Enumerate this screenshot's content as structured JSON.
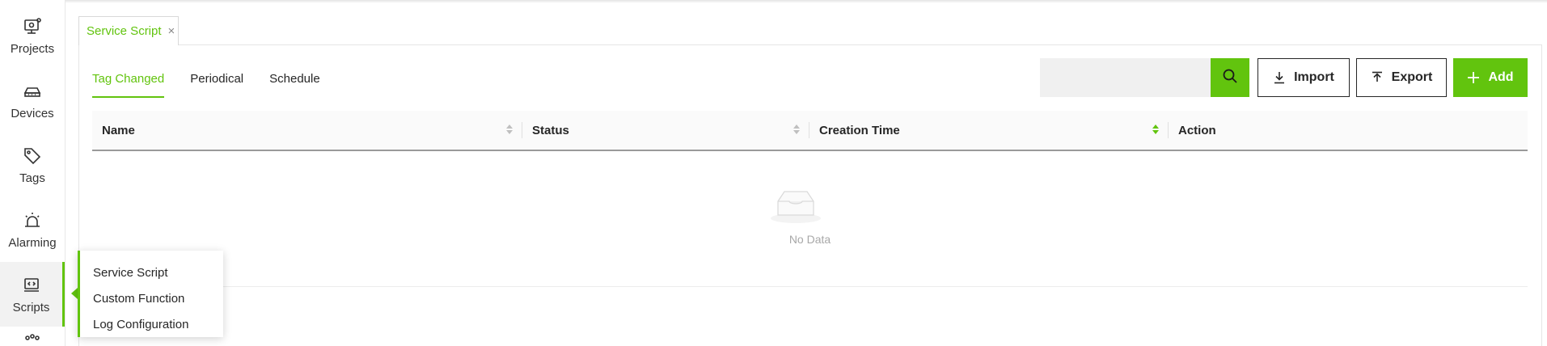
{
  "sidebar": {
    "items": [
      {
        "label": "Projects",
        "icon": "projects-icon"
      },
      {
        "label": "Devices",
        "icon": "devices-icon"
      },
      {
        "label": "Tags",
        "icon": "tag-icon"
      },
      {
        "label": "Alarming",
        "icon": "alarm-icon"
      },
      {
        "label": "Scripts",
        "icon": "scripts-icon",
        "active": true
      }
    ]
  },
  "flyout": {
    "items": [
      {
        "label": "Service Script"
      },
      {
        "label": "Custom Function"
      },
      {
        "label": "Log Configuration"
      }
    ]
  },
  "page_tab": {
    "label": "Service Script",
    "close": "×"
  },
  "subtabs": [
    {
      "label": "Tag Changed",
      "active": true
    },
    {
      "label": "Periodical"
    },
    {
      "label": "Schedule"
    }
  ],
  "toolbar": {
    "search_placeholder": "",
    "import_label": "Import",
    "export_label": "Export",
    "add_label": "Add"
  },
  "table": {
    "columns": [
      {
        "label": "Name",
        "sortable": true
      },
      {
        "label": "Status",
        "sortable": true
      },
      {
        "label": "Creation Time",
        "sortable": true,
        "sorted": true
      },
      {
        "label": "Action",
        "sortable": false
      }
    ],
    "rows": [],
    "empty_text": "No Data"
  },
  "colors": {
    "accent": "#62c40e",
    "text": "#262626",
    "muted": "#a8a8a8"
  }
}
